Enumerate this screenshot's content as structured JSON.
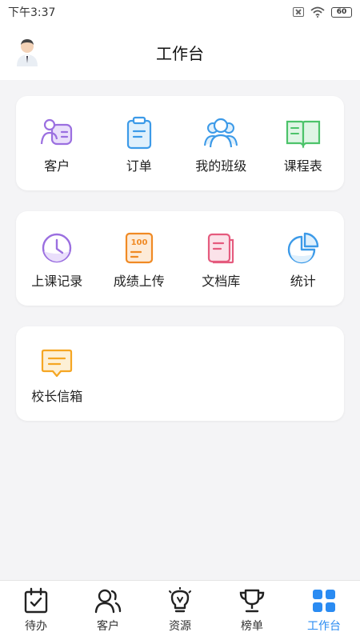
{
  "status_bar": {
    "time": "下午3:37",
    "battery": "60"
  },
  "header": {
    "title": "工作台"
  },
  "cards": [
    {
      "items": [
        {
          "label": "客户",
          "icon": "customer-card-icon"
        },
        {
          "label": "订单",
          "icon": "clipboard-icon"
        },
        {
          "label": "我的班级",
          "icon": "class-group-icon"
        },
        {
          "label": "课程表",
          "icon": "open-book-icon"
        }
      ]
    },
    {
      "items": [
        {
          "label": "上课记录",
          "icon": "clock-icon"
        },
        {
          "label": "成绩上传",
          "icon": "score-100-icon"
        },
        {
          "label": "文档库",
          "icon": "document-icon"
        },
        {
          "label": "统计",
          "icon": "pie-chart-icon"
        }
      ]
    },
    {
      "items": [
        {
          "label": "校长信箱",
          "icon": "message-box-icon"
        }
      ]
    }
  ],
  "tabbar": {
    "items": [
      {
        "label": "待办",
        "icon": "calendar-check-icon"
      },
      {
        "label": "客户",
        "icon": "users-icon"
      },
      {
        "label": "资源",
        "icon": "lightbulb-icon"
      },
      {
        "label": "榜单",
        "icon": "trophy-icon"
      },
      {
        "label": "工作台",
        "icon": "grid-icon"
      }
    ],
    "active_index": 4
  },
  "colors": {
    "purple": "#9b6fe0",
    "blue": "#3c9ae8",
    "green": "#4cc36a",
    "orange": "#f08a24",
    "pink": "#e55b7e",
    "yellow": "#f5a623",
    "tab_active": "#2a8bf2"
  }
}
